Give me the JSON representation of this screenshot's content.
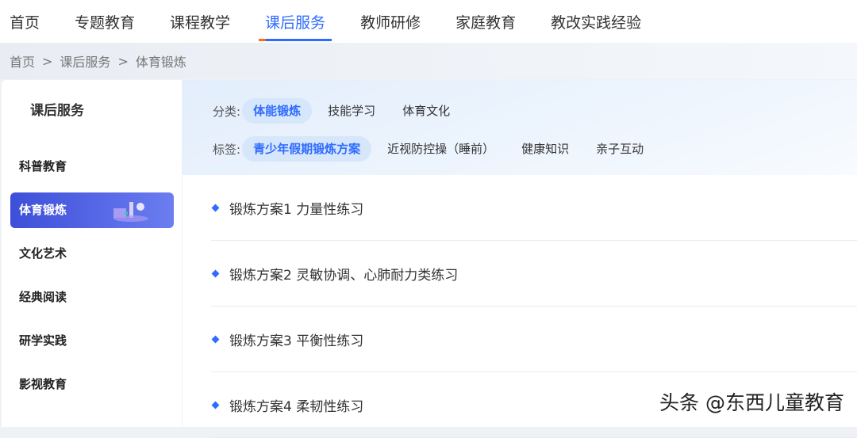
{
  "nav": [
    "首页",
    "专题教育",
    "课程教学",
    "课后服务",
    "教师研修",
    "家庭教育",
    "教改实践经验"
  ],
  "breadcrumb": [
    "首页",
    "课后服务",
    "体育锻炼"
  ],
  "breadcrumb_sep": ">",
  "sidebar": {
    "title": "课后服务",
    "items": [
      "科普教育",
      "体育锻炼",
      "文化艺术",
      "经典阅读",
      "研学实践",
      "影视教育"
    ]
  },
  "filters": {
    "category_label": "分类:",
    "categories": [
      "体能锻炼",
      "技能学习",
      "体育文化"
    ],
    "tag_label": "标签:",
    "tags": [
      "青少年假期锻炼方案",
      "近视防控操（睡前）",
      "健康知识",
      "亲子互动"
    ]
  },
  "list": [
    "锻炼方案1 力量性练习",
    "锻炼方案2 灵敏协调、心肺耐力类练习",
    "锻炼方案3 平衡性练习",
    "锻炼方案4 柔韧性练习"
  ],
  "watermark": "头条 @东西儿童教育"
}
